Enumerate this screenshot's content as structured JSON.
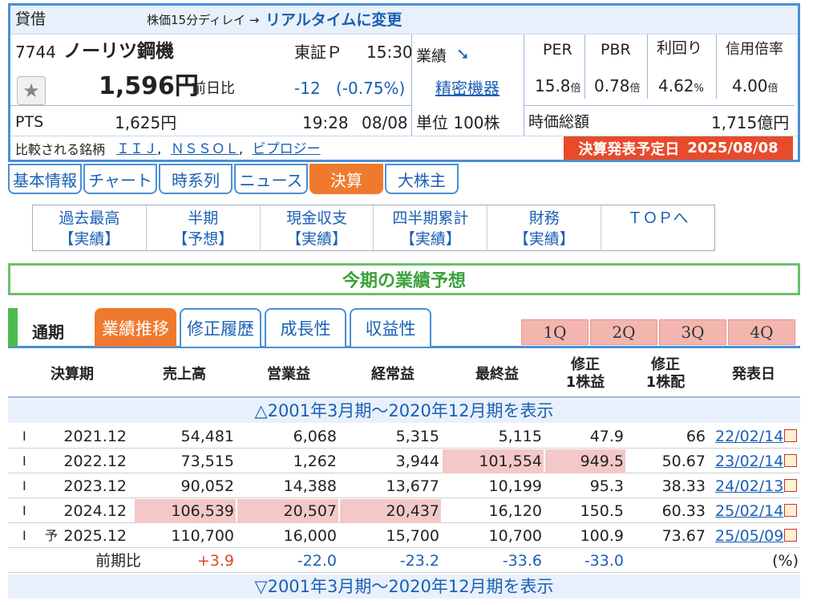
{
  "header": {
    "type_label": "貸借",
    "delay_note": "株価15分ディレイ →",
    "realtime_link": "リアルタイムに変更",
    "code": "7744",
    "name": "ノーリツ鋼機",
    "market": "東証Ｐ",
    "time": "15:30",
    "perf_label": "業績",
    "price": "1,596円",
    "prev_label": "前日比",
    "change": "-12",
    "change_pct": "(-0.75%)",
    "sector": "精密機器",
    "unit": "単位 100株",
    "pts_label": "PTS",
    "pts_price": "1,625円",
    "pts_time": "19:28",
    "pts_date": "08/08",
    "compare_label": "比較される銘柄",
    "compare": [
      "ＩＩＪ",
      "ＮＳＳＯＬ",
      "ビプロジー"
    ],
    "earnings_label": "決算発表予定日",
    "earnings_date": "2025/08/08",
    "metrics": [
      {
        "label": "PER",
        "value": "15.8",
        "unit": "倍"
      },
      {
        "label": "PBR",
        "value": "0.78",
        "unit": "倍"
      },
      {
        "label": "利回り",
        "value": "4.62",
        "unit": "%"
      },
      {
        "label": "信用倍率",
        "value": "4.00",
        "unit": "倍"
      }
    ],
    "mcap_label": "時価総額",
    "mcap_value": "1,715億円"
  },
  "tabs": [
    "基本情報",
    "チャート",
    "時系列",
    "ニュース",
    "決算",
    "大株主"
  ],
  "subnav": [
    {
      "l1": "過去最高",
      "l2": "【実績】"
    },
    {
      "l1": "半期",
      "l2": "【予想】"
    },
    {
      "l1": "現金収支",
      "l2": "【実績】"
    },
    {
      "l1": "四半期累計",
      "l2": "【実績】"
    },
    {
      "l1": "財務",
      "l2": "【実績】"
    },
    {
      "l1": "ＴＯＰへ",
      "l2": ""
    }
  ],
  "banner": "今期の業績予想",
  "ltabs": {
    "period": "通期",
    "tabs": [
      "業績推移",
      "修正履歴",
      "成長性",
      "収益性"
    ],
    "quarters": [
      "1Q",
      "2Q",
      "3Q",
      "4Q"
    ]
  },
  "table": {
    "headers": {
      "period": "決算期",
      "sales": "売上高",
      "op": "営業益",
      "ord": "経常益",
      "net": "最終益",
      "eps1": "修正",
      "eps2": "1株益",
      "div1": "修正",
      "div2": "1株配",
      "date": "発表日"
    },
    "toggle_top": "△2001年3月期～2020年12月期を表示",
    "toggle_bottom": "▽2001年3月期～2020年12月期を表示",
    "rows": [
      {
        "mark": "I",
        "fc": "",
        "period": "2021.12",
        "sales": "54,481",
        "op": "6,068",
        "ord": "5,315",
        "net": "5,115",
        "eps": "47.9",
        "div": "66",
        "date": "22/02/14"
      },
      {
        "mark": "I",
        "fc": "",
        "period": "2022.12",
        "sales": "73,515",
        "op": "1,262",
        "ord": "3,944",
        "net": "101,554",
        "eps": "949.5",
        "div": "50.67",
        "date": "23/02/14"
      },
      {
        "mark": "I",
        "fc": "",
        "period": "2023.12",
        "sales": "90,052",
        "op": "14,388",
        "ord": "13,677",
        "net": "10,199",
        "eps": "95.3",
        "div": "38.33",
        "date": "24/02/13"
      },
      {
        "mark": "I",
        "fc": "",
        "period": "2024.12",
        "sales": "106,539",
        "op": "20,507",
        "ord": "20,437",
        "net": "16,120",
        "eps": "150.5",
        "div": "60.33",
        "date": "25/02/14"
      },
      {
        "mark": "I",
        "fc": "予",
        "period": "2025.12",
        "sales": "110,700",
        "op": "16,000",
        "ord": "15,700",
        "net": "10,700",
        "eps": "100.9",
        "div": "73.67",
        "date": "25/05/09"
      }
    ],
    "yoy": {
      "label": "前期比",
      "sales": "+3.9",
      "op": "-22.0",
      "ord": "-23.2",
      "net": "-33.6",
      "eps": "-33.0",
      "unit": "(%)"
    }
  }
}
